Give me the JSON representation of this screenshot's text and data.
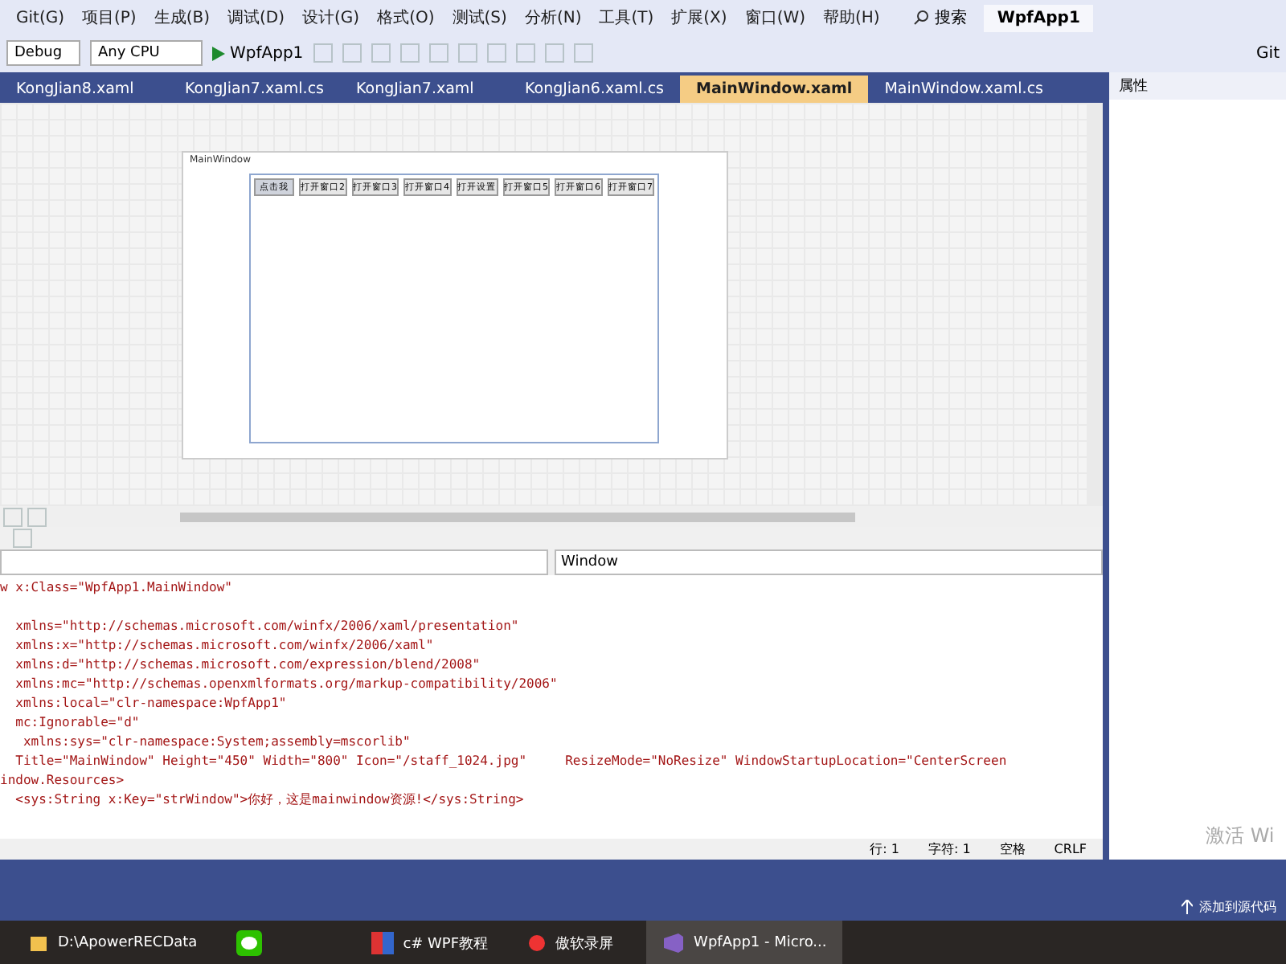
{
  "menu": [
    "Git(G)",
    "项目(P)",
    "生成(B)",
    "调试(D)",
    "设计(G)",
    "格式(O)",
    "测试(S)",
    "分析(N)",
    "工具(T)",
    "扩展(X)",
    "窗口(W)",
    "帮助(H)"
  ],
  "search": {
    "label": "搜索"
  },
  "solution_badge": "WpfApp1",
  "toolbar": {
    "config": "Debug",
    "platform": "Any CPU",
    "start": "WpfApp1",
    "account": "Git"
  },
  "tabs": [
    {
      "label": "KongJian8.xaml",
      "selected": false
    },
    {
      "label": "KongJian7.xaml.cs",
      "selected": false
    },
    {
      "label": "KongJian7.xaml",
      "selected": false
    },
    {
      "label": "KongJian6.xaml.cs",
      "selected": false
    },
    {
      "label": "MainWindow.xaml",
      "selected": true
    },
    {
      "label": "MainWindow.xaml.cs",
      "selected": false
    }
  ],
  "properties_panel": {
    "title": "属性"
  },
  "designer": {
    "window_title": "MainWindow",
    "buttons": [
      {
        "label": "点击我",
        "selected": true
      },
      {
        "label": "打开窗口2",
        "selected": false
      },
      {
        "label": "打开窗口3",
        "selected": false
      },
      {
        "label": "打开窗口4",
        "selected": false
      },
      {
        "label": "打开设置",
        "selected": false
      },
      {
        "label": "打开窗口5",
        "selected": false
      },
      {
        "label": "打开窗口6",
        "selected": false
      },
      {
        "label": "打开窗口7",
        "selected": false
      }
    ]
  },
  "element_dropdown": "Window",
  "code_lines": [
    "w x:Class=\"WpfApp1.MainWindow\"",
    "  xmlns=\"http://schemas.microsoft.com/winfx/2006/xaml/presentation\"",
    "  xmlns:x=\"http://schemas.microsoft.com/winfx/2006/xaml\"",
    "  xmlns:d=\"http://schemas.microsoft.com/expression/blend/2008\"",
    "  xmlns:mc=\"http://schemas.openxmlformats.org/markup-compatibility/2006\"",
    "  xmlns:local=\"clr-namespace:WpfApp1\"",
    "  mc:Ignorable=\"d\"",
    "   xmlns:sys=\"clr-namespace:System;assembly=mscorlib\"",
    "  Title=\"MainWindow\" Height=\"450\" Width=\"800\" Icon=\"/staff_1024.jpg\"     ResizeMode=\"NoResize\" WindowStartupLocation=\"CenterScreen",
    "indow.Resources>",
    "  <sys:String x:Key=\"strWindow\">你好，这是mainwindow资源!</sys:String>"
  ],
  "status": [
    "行: 1",
    "字符: 1",
    "空格",
    "CRLF"
  ],
  "activation_notice": "激活 Wi",
  "source_control": "添加到源代码",
  "taskbar": [
    {
      "label": "D:\\ApowerRECData",
      "kind": "folder",
      "selected": false
    },
    {
      "kind": "wechat",
      "selected": false
    },
    {
      "label": "c# WPF教程",
      "kind": "app",
      "selected": false
    },
    {
      "label": "傲软录屏",
      "kind": "record",
      "selected": false
    },
    {
      "label": "WpfApp1 - Micro...",
      "kind": "vs",
      "selected": true
    }
  ]
}
